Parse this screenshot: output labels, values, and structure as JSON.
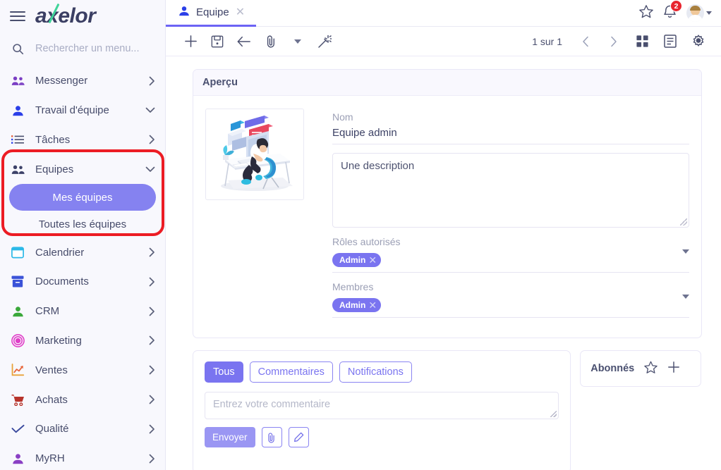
{
  "sidebar": {
    "logo": "axelor",
    "search": {
      "placeholder": "Rechercher un menu..."
    },
    "items": [
      {
        "label": "Messenger",
        "icon": "people-icon",
        "chevron": "right"
      },
      {
        "label": "Travail d'équipe",
        "icon": "person-icon",
        "chevron": "down"
      },
      {
        "label": "Tâches",
        "icon": "list-icon",
        "chevron": "right"
      },
      {
        "label": "Equipes",
        "icon": "people-icon",
        "chevron": "down"
      },
      {
        "label": "Calendrier",
        "icon": "calendar-icon",
        "chevron": "right"
      },
      {
        "label": "Documents",
        "icon": "archive-icon",
        "chevron": "right"
      },
      {
        "label": "CRM",
        "icon": "person-icon",
        "chevron": "right"
      },
      {
        "label": "Marketing",
        "icon": "target-icon",
        "chevron": "right"
      },
      {
        "label": "Ventes",
        "icon": "chart-up-icon",
        "chevron": "right"
      },
      {
        "label": "Achats",
        "icon": "cart-icon",
        "chevron": "right"
      },
      {
        "label": "Qualité",
        "icon": "check-icon",
        "chevron": "right"
      },
      {
        "label": "MyRH",
        "icon": "person-icon",
        "chevron": "right"
      }
    ],
    "equipes_submenu": [
      {
        "label": "Mes équipes",
        "active": true
      },
      {
        "label": "Toutes les équipes",
        "active": false
      }
    ],
    "highlight_color": "#ec1c24",
    "active_pill_color": "#8582f0"
  },
  "topbar": {
    "tab": {
      "label": "Equipe",
      "icon": "person-icon",
      "close_icon": "close-icon"
    },
    "star_icon": "star-icon",
    "notifications": {
      "icon": "bell-icon",
      "count": "2",
      "badge_color": "#e8242e"
    },
    "avatar_icon": "avatar",
    "accent_color": "#6c63f5"
  },
  "toolbar": {
    "buttons": [
      {
        "name": "new",
        "icon": "plus-icon"
      },
      {
        "name": "save",
        "icon": "save-icon"
      },
      {
        "name": "back",
        "icon": "arrow-left-icon"
      },
      {
        "name": "attachment",
        "icon": "paperclip-icon"
      },
      {
        "name": "more",
        "icon": "caret-down-icon"
      },
      {
        "name": "tools",
        "icon": "magic-wand-icon"
      }
    ],
    "pager": "1 sur 1",
    "prev_icon": "chevron-left-icon",
    "next_icon": "chevron-right-icon",
    "grid_view_icon": "grid-view-icon",
    "form_view_icon": "form-view-icon",
    "settings_icon": "gear-icon"
  },
  "form": {
    "panel_title": "Aperçu",
    "image_alt": "person-at-desk-illustration",
    "nom": {
      "label": "Nom",
      "value": "Equipe admin"
    },
    "description": {
      "value": "Une description"
    },
    "roles": {
      "label": "Rôles autorisés",
      "chips": [
        {
          "label": "Admin",
          "remove_icon": "close-icon"
        }
      ],
      "dropdown_icon": "caret-down-icon"
    },
    "membres": {
      "label": "Membres",
      "chips": [
        {
          "label": "Admin",
          "remove_icon": "close-icon"
        }
      ],
      "dropdown_icon": "caret-down-icon"
    },
    "chip_color": "#7a74f0"
  },
  "comments": {
    "tabs": [
      {
        "label": "Tous",
        "active": true
      },
      {
        "label": "Commentaires",
        "active": false
      },
      {
        "label": "Notifications",
        "active": false
      }
    ],
    "input_placeholder": "Entrez votre commentaire",
    "send_label": "Envoyer",
    "attach_icon": "paperclip-icon",
    "edit_icon": "pencil-icon"
  },
  "followers": {
    "title": "Abonnés",
    "star_icon": "star-icon",
    "add_icon": "plus-icon"
  }
}
